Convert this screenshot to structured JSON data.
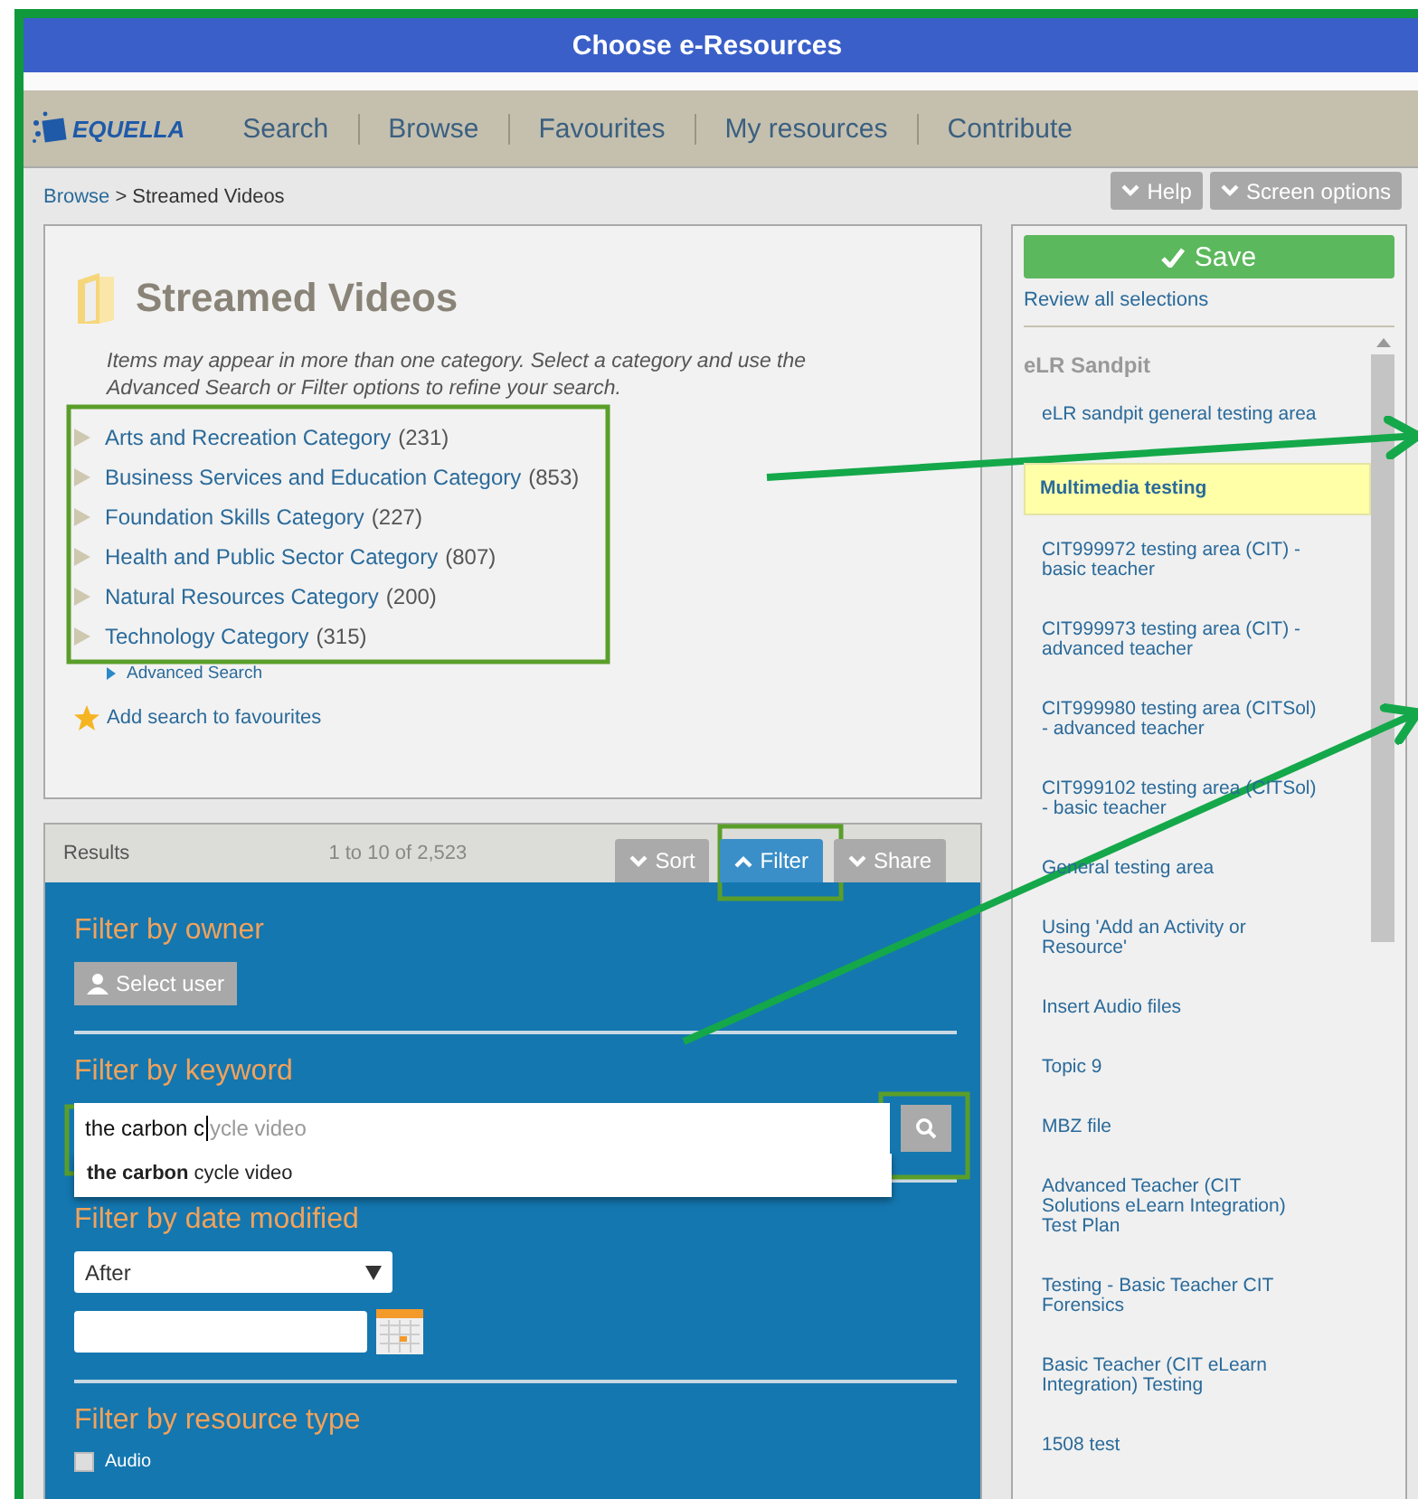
{
  "window": {
    "title": "Choose e-Resources"
  },
  "nav": {
    "logo": "EQUELLA",
    "items": [
      "Search",
      "Browse",
      "Favourites",
      "My resources",
      "Contribute"
    ]
  },
  "breadcrumb": {
    "link": "Browse",
    "separator": ">",
    "current": "Streamed Videos"
  },
  "header_buttons": [
    "Help",
    "Screen options"
  ],
  "category": {
    "title": "Streamed Videos",
    "description": "Items may appear in more than one category. Select a category and use the Advanced Search or Filter options to refine your search.",
    "items": [
      {
        "name": "Arts and Recreation Category",
        "count": "(231)"
      },
      {
        "name": "Business Services and Education Category",
        "count": "(853)"
      },
      {
        "name": "Foundation Skills Category",
        "count": "(227)"
      },
      {
        "name": "Health and Public Sector Category",
        "count": "(807)"
      },
      {
        "name": "Natural Resources Category",
        "count": "(200)"
      },
      {
        "name": "Technology Category",
        "count": "(315)"
      }
    ],
    "advanced_search": "Advanced Search",
    "favourites": "Add search to favourites"
  },
  "results": {
    "label": "Results",
    "count": "1 to 10 of 2,523",
    "tabs": [
      {
        "label": "Sort",
        "selected": false
      },
      {
        "label": "Filter",
        "selected": true
      },
      {
        "label": "Share",
        "selected": false
      }
    ]
  },
  "filters": {
    "owner": {
      "heading": "Filter by owner",
      "button": "Select user"
    },
    "keyword": {
      "heading": "Filter by keyword",
      "value": "the carbon c",
      "completion": "ycle video",
      "suggestion": "**the carbon** cycle video"
    },
    "date": {
      "heading": "Filter by date modified",
      "select": "After"
    },
    "resource_type": {
      "heading": "Filter by resource type",
      "options": [
        {
          "label": "Audio",
          "checked": false
        }
      ]
    }
  },
  "sidebar": {
    "save": "Save",
    "review": "Review all selections",
    "course": "eLR Sandpit",
    "items": [
      {
        "label": "eLR sandpit general testing area",
        "selected": false
      },
      {
        "label": "Multimedia testing",
        "selected": true
      },
      {
        "label": "CIT999972 testing area (CIT) - basic teacher",
        "selected": false
      },
      {
        "label": "CIT999973 testing area (CIT) - advanced teacher",
        "selected": false
      },
      {
        "label": "CIT999980 testing area (CITSol) - advanced teacher",
        "selected": false
      },
      {
        "label": "CIT999102 testing area (CITSol) - basic teacher",
        "selected": false
      },
      {
        "label": "General testing area",
        "selected": false
      },
      {
        "label": "Using 'Add an Activity or Resource'",
        "selected": false
      },
      {
        "label": "Insert Audio files",
        "selected": false
      },
      {
        "label": "Topic 9",
        "selected": false
      },
      {
        "label": "MBZ file",
        "selected": false
      },
      {
        "label": "Advanced Teacher (CIT Solutions eLearn Integration) Test Plan",
        "selected": false
      },
      {
        "label": "Testing - Basic Teacher CIT Forensics",
        "selected": false
      },
      {
        "label": "Basic Teacher (CIT eLearn Integration) Testing",
        "selected": false
      },
      {
        "label": "1508 test",
        "selected": false
      }
    ]
  }
}
